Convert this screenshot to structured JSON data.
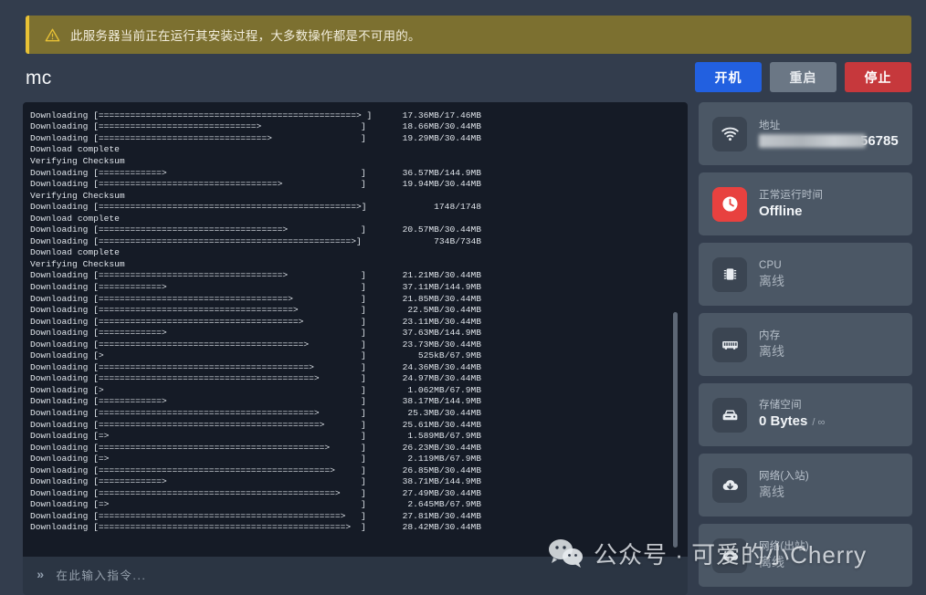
{
  "alert": {
    "icon": "warning-triangle-icon",
    "message": "此服务器当前正在运行其安装过程，大多数操作都是不可用的。"
  },
  "header": {
    "title": "mc",
    "buttons": {
      "start": "开机",
      "restart": "重启",
      "stop": "停止"
    }
  },
  "console": {
    "lines": [
      {
        "label": "Downloading [=================================================> ]",
        "value": "17.36MB/17.46MB"
      },
      {
        "label": "Downloading [==============================>",
        "value": "18.66MB/30.44MB"
      },
      {
        "label": "Downloading [================================>",
        "value": "19.29MB/30.44MB"
      },
      {
        "label": "Download complete",
        "value": ""
      },
      {
        "label": "Verifying Checksum",
        "value": ""
      },
      {
        "label": "Downloading [============>",
        "value": "36.57MB/144.9MB"
      },
      {
        "label": "Downloading [==================================>",
        "value": "19.94MB/30.44MB"
      },
      {
        "label": "Verifying Checksum",
        "value": ""
      },
      {
        "label": "Downloading [=================================================>]",
        "value": "1748/1748"
      },
      {
        "label": "Download complete",
        "value": ""
      },
      {
        "label": "Downloading [===================================>",
        "value": "20.57MB/30.44MB"
      },
      {
        "label": "Downloading [================================================>]",
        "value": "734B/734B"
      },
      {
        "label": "Download complete",
        "value": ""
      },
      {
        "label": "Verifying Checksum",
        "value": ""
      },
      {
        "label": "Downloading [===================================>",
        "value": "21.21MB/30.44MB"
      },
      {
        "label": "Downloading [============>",
        "value": "37.11MB/144.9MB"
      },
      {
        "label": "Downloading [====================================>",
        "value": "21.85MB/30.44MB"
      },
      {
        "label": "Downloading [=====================================>",
        "value": "22.5MB/30.44MB"
      },
      {
        "label": "Downloading [======================================>",
        "value": "23.11MB/30.44MB"
      },
      {
        "label": "Downloading [============>",
        "value": "37.63MB/144.9MB"
      },
      {
        "label": "Downloading [=======================================>",
        "value": "23.73MB/30.44MB"
      },
      {
        "label": "Downloading [>",
        "value": "525kB/67.9MB"
      },
      {
        "label": "Downloading [========================================>",
        "value": "24.36MB/30.44MB"
      },
      {
        "label": "Downloading [=========================================>",
        "value": "24.97MB/30.44MB"
      },
      {
        "label": "Downloading [>",
        "value": "1.062MB/67.9MB"
      },
      {
        "label": "Downloading [============>",
        "value": "38.17MB/144.9MB"
      },
      {
        "label": "Downloading [=========================================>",
        "value": "25.3MB/30.44MB"
      },
      {
        "label": "Downloading [==========================================>",
        "value": "25.61MB/30.44MB"
      },
      {
        "label": "Downloading [=>",
        "value": "1.589MB/67.9MB"
      },
      {
        "label": "Downloading [===========================================>",
        "value": "26.23MB/30.44MB"
      },
      {
        "label": "Downloading [=>",
        "value": "2.119MB/67.9MB"
      },
      {
        "label": "Downloading [============================================>",
        "value": "26.85MB/30.44MB"
      },
      {
        "label": "Downloading [============>",
        "value": "38.71MB/144.9MB"
      },
      {
        "label": "Downloading [=============================================>",
        "value": "27.49MB/30.44MB"
      },
      {
        "label": "Downloading [=>",
        "value": "2.645MB/67.9MB"
      },
      {
        "label": "Downloading [==============================================>",
        "value": "27.81MB/30.44MB"
      },
      {
        "label": "Downloading [===============================================>",
        "value": "28.42MB/30.44MB"
      }
    ]
  },
  "command_bar": {
    "prefix": "»",
    "placeholder": "在此输入指令...",
    "value": ""
  },
  "sidebar": {
    "cards": [
      {
        "icon": "wifi-icon",
        "label": "地址",
        "value": "",
        "port": "56785",
        "type": "address"
      },
      {
        "icon": "clock-icon",
        "label": "正常运行时间",
        "value": "Offline",
        "type": "strong"
      },
      {
        "icon": "cpu-icon",
        "label": "CPU",
        "value": "离线",
        "type": "dim"
      },
      {
        "icon": "memory-icon",
        "label": "内存",
        "value": "离线",
        "type": "dim"
      },
      {
        "icon": "storage-icon",
        "label": "存储空间",
        "value": "0 Bytes",
        "suffix": "/ ∞",
        "type": "strong"
      },
      {
        "icon": "cloud-download-icon",
        "label": "网络(入站)",
        "value": "离线",
        "type": "dim"
      },
      {
        "icon": "cloud-upload-icon",
        "label": "网络(出站)",
        "value": "离线",
        "type": "dim"
      }
    ]
  },
  "watermark": {
    "icon": "wechat-icon",
    "text": "公众号 · 可爱的小Cherry"
  },
  "colors": {
    "page_bg": "#333d4d",
    "console_bg": "#151b26",
    "card_bg": "#4b5765",
    "accent_blue": "#2260e0",
    "accent_red": "#c6383c",
    "alert_bg": "#7c7030",
    "alert_border": "#e8c135"
  }
}
